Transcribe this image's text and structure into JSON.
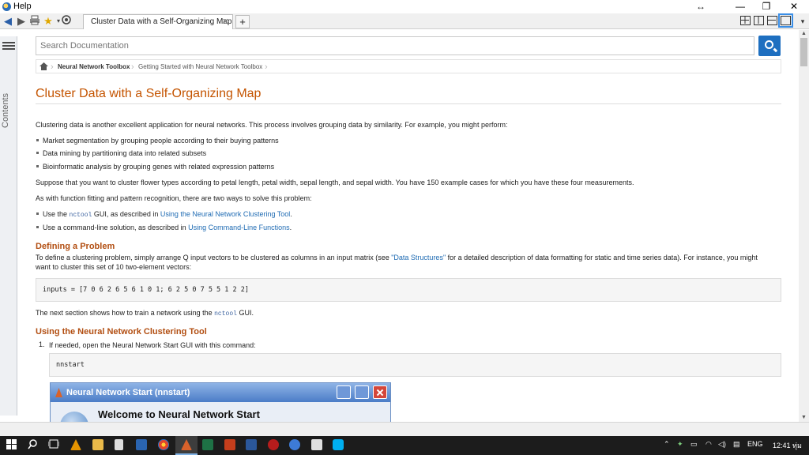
{
  "window": {
    "title": "Help",
    "controls": {
      "resize": "↔",
      "minimize": "—",
      "restore": "❐",
      "close": "✕"
    }
  },
  "toolbar": {
    "icons": [
      "back-icon",
      "forward-icon",
      "print-icon",
      "favorites-star-icon",
      "settings-icon"
    ],
    "tab": {
      "label": "Cluster Data with a Self-Organizing Map",
      "close": "✕"
    },
    "new_tab": "+"
  },
  "sidebar": {
    "label": "Contents"
  },
  "search": {
    "placeholder": "Search Documentation"
  },
  "breadcrumb": [
    "Neural Network Toolbox",
    "Getting Started with Neural Network Toolbox"
  ],
  "page": {
    "title": "Cluster Data with a Self-Organizing Map",
    "intro": "Clustering data is another excellent application for neural networks. This process involves grouping data by similarity. For example, you might perform:",
    "bullets": [
      "Market segmentation by grouping people according to their buying patterns",
      "Data mining by partitioning data into related subsets",
      "Bioinformatic analysis by grouping genes with related expression patterns"
    ],
    "p2": "Suppose that you want to cluster flower types according to petal length, petal width, sepal length, and sepal width. You have 150 example cases for which you have these four measurements.",
    "p3": "As with function fitting and pattern recognition, there are two ways to solve this problem:",
    "ways": {
      "w1_pre": "Use the ",
      "w1_code": "nctool",
      "w1_mid": " GUI, as described in ",
      "w1_link": "Using the Neural Network Clustering Tool",
      "w1_post": ".",
      "w2_pre": "Use a command-line solution, as described in ",
      "w2_link": "Using Command-Line Functions",
      "w2_post": "."
    },
    "section1": {
      "heading": "Defining a Problem",
      "text_pre": "To define a clustering problem, simply arrange Q input vectors to be clustered as columns in an input matrix (see ",
      "text_link": "\"Data Structures\"",
      "text_post": " for a detailed description of data formatting for static and time series data). For instance, you might",
      "text_line2": "want to cluster this set of 10 two-element vectors:",
      "code": "inputs = [7 0 6 2 6 5 6 1 0 1; 6 2 5 0 7 5 5 1 2 2]",
      "after_pre": "The next section shows how to train a network using the ",
      "after_code": "nctool",
      "after_post": " GUI."
    },
    "section2": {
      "heading": "Using the Neural Network Clustering Tool",
      "step1_num": "1.",
      "step1": "If needed, open the Neural Network Start GUI with this command:",
      "code": "nnstart"
    },
    "nnstart_window": {
      "title": "Neural Network Start (nnstart)",
      "welcome": "Welcome to Neural Network Start"
    }
  },
  "taskbar": {
    "language": "ENG",
    "time": "12:41 ทุ่ม"
  },
  "colors": {
    "title_orange": "#c45400",
    "link_blue": "#1f6bb3",
    "search_button": "#1e6fc0",
    "taskbar": "#1c1c1c"
  }
}
